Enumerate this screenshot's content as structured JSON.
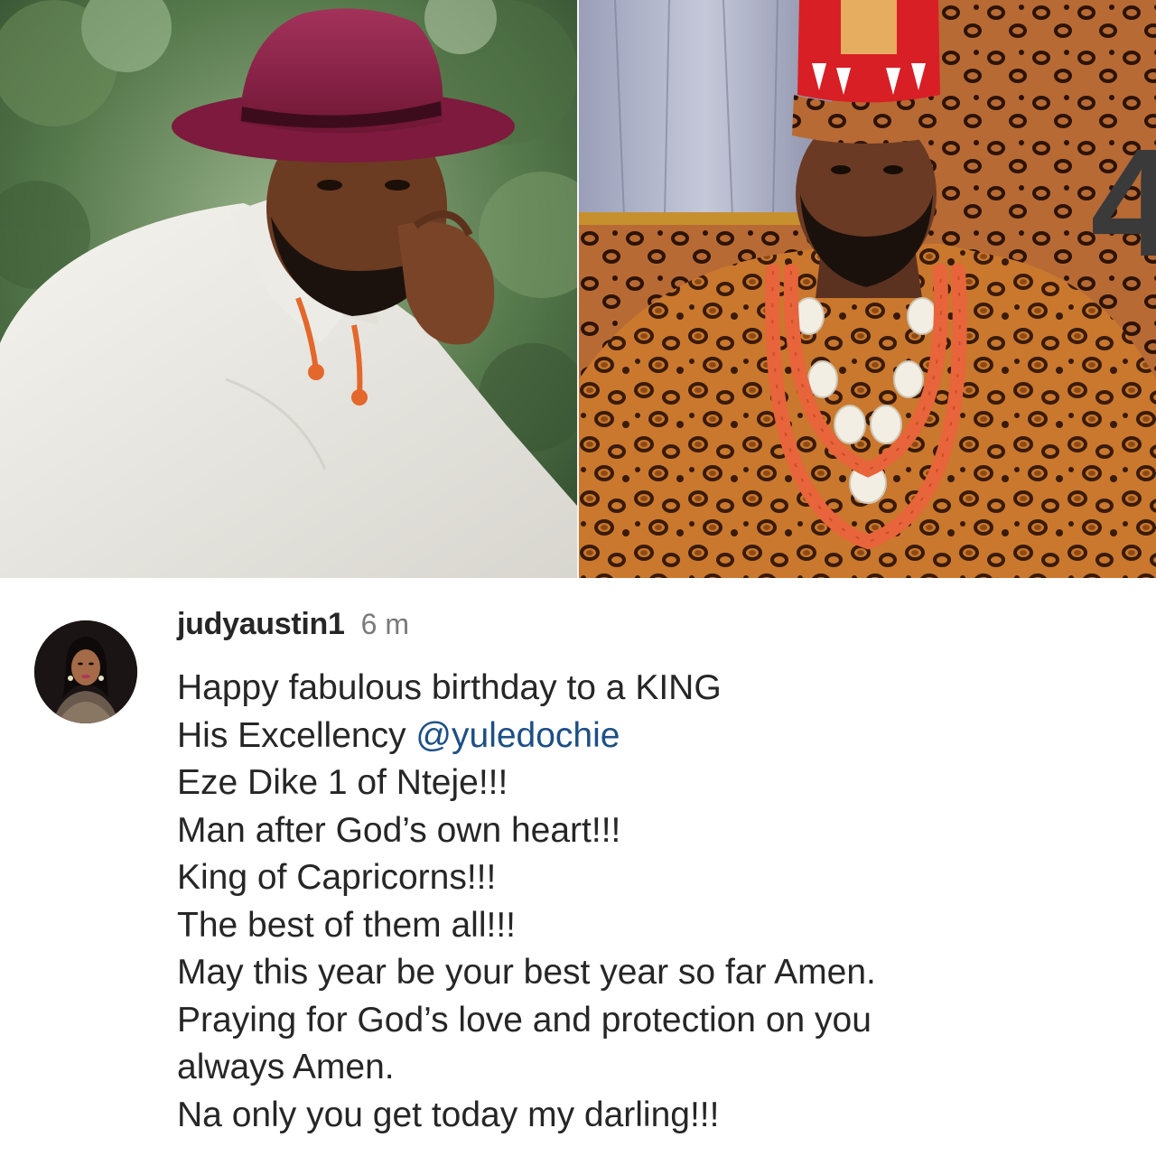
{
  "post": {
    "image_counter": "4"
  },
  "comment": {
    "username": "judyaustin1",
    "timestamp": "6 m",
    "lines": {
      "l1": "Happy fabulous birthday to a KING",
      "l2_prefix": "His Excellency ",
      "l2_mention": "@yuledochie",
      "l3": "Eze Dike 1 of Nteje!!!",
      "l4": "Man after God’s own heart!!!",
      "l5": "King of Capricorns!!!",
      "l6": "The best of them all!!!",
      "l7": "May this year be your best year so far Amen.",
      "l8": "Praying for God’s love and protection on you",
      "l9": "always Amen.",
      "l10": "Na only you get today my darling!!!"
    }
  },
  "colors": {
    "text": "#262626",
    "mention": "#1d4f86",
    "timestamp": "#7a7a7a",
    "hat": "#8e1f47",
    "crown": "#d81f26",
    "coral_beads": "#e8643a",
    "leopard_base": "#c9782e"
  }
}
